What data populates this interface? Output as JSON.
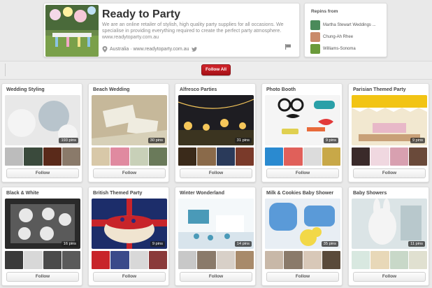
{
  "profile": {
    "name": "Ready to Party",
    "about": "We are an online retailer of stylish, high quality party supplies for all occasions. We specialise in providing everything required to create the perfect party atmosphere. www.readytoparty.com.au",
    "location": "Australia",
    "website": "www.readytoparty.com.au"
  },
  "repins": {
    "title": "Repins from",
    "sources": [
      {
        "name": "Martha Stewart Weddings ...",
        "color": "#4a8a5a"
      },
      {
        "name": "Chung-Ah Rhee",
        "color": "#c98a6a"
      },
      {
        "name": "Williams-Sonoma",
        "color": "#6a9a3a"
      }
    ]
  },
  "follow_all_label": "Follow All",
  "boards": [
    {
      "title": "Wedding Styling",
      "pins": "193 pins",
      "follow_label": "Follow",
      "cover": [
        "#e8e8e8",
        "#b8c4cc",
        "#f4f4f4"
      ],
      "thumbs": [
        "#bcbcbc",
        "#3a4a3c",
        "#5a2a1a",
        "#8a7a6a"
      ]
    },
    {
      "title": "Beach Wedding",
      "pins": "30 pins",
      "follow_label": "Follow",
      "cover": [
        "#d7d0b8",
        "#c6b89a",
        "#efece0"
      ],
      "thumbs": [
        "#d8c8a8",
        "#e08aa0",
        "#c8d0b8",
        "#6a7a5a"
      ]
    },
    {
      "title": "Alfresco Parties",
      "pins": "31 pins",
      "follow_label": "Follow",
      "cover": [
        "#1e1d22",
        "#3b3420",
        "#f5c65a"
      ],
      "thumbs": [
        "#3a2a1a",
        "#8a6a4a",
        "#2a3a5a",
        "#7a3a2a"
      ]
    },
    {
      "title": "Photo Booth",
      "pins": "9 pins",
      "follow_label": "Follow",
      "cover": [
        "#f5f5f5",
        "#e23a3a",
        "#1a1a1a"
      ],
      "thumbs": [
        "#2a8ad0",
        "#e0605a",
        "#dcdcdc",
        "#c8a848"
      ]
    },
    {
      "title": "Parisian Themed Party",
      "pins": "9 pins",
      "follow_label": "Follow",
      "cover": [
        "#f2e8d0",
        "#f2c414",
        "#ffffff"
      ],
      "thumbs": [
        "#3a2a2a",
        "#f0d8e0",
        "#d8a0b0",
        "#6a4a3a"
      ]
    },
    {
      "title": "Black & White",
      "pins": "16 pins",
      "follow_label": "Follow",
      "cover": [
        "#2a2a2a",
        "#e8e8e8",
        "#5a5a5a"
      ],
      "thumbs": [
        "#3a3a3a",
        "#d8d8d8",
        "#4a4a4a",
        "#5a5a5a"
      ]
    },
    {
      "title": "British Themed Party",
      "pins": "9 pins",
      "follow_label": "Follow",
      "cover": [
        "#1c2d6a",
        "#c8242a",
        "#f0e4d0"
      ],
      "thumbs": [
        "#c8242a",
        "#3a4a8a",
        "#d8d8d8",
        "#8a3a3a"
      ]
    },
    {
      "title": "Winter Wonderland",
      "pins": "14 pins",
      "follow_label": "Follow",
      "cover": [
        "#d8e4ec",
        "#4a9ab8",
        "#f4f8fa"
      ],
      "thumbs": [
        "#c8c8c8",
        "#8a7a6a",
        "#d8d0c8",
        "#a88a6a"
      ]
    },
    {
      "title": "Milk & Cookies Baby Shower",
      "pins": "35 pins",
      "follow_label": "Follow",
      "cover": [
        "#5a9ad8",
        "#f2d848",
        "#e8eef4"
      ],
      "thumbs": [
        "#c8b8a8",
        "#8a7a6a",
        "#d8c8b8",
        "#5a4a3a"
      ]
    },
    {
      "title": "Baby Showers",
      "pins": "11 pins",
      "follow_label": "Follow",
      "cover": [
        "#dbe4e6",
        "#f4f4f4",
        "#b8c8cc"
      ],
      "thumbs": [
        "#d8e8e0",
        "#e8d8b8",
        "#c8d8c8",
        "#e0e0d0"
      ]
    }
  ]
}
